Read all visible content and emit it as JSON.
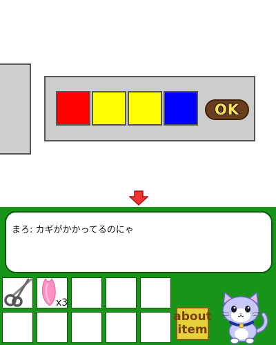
{
  "lock": {
    "slots": [
      {
        "color_name": "red",
        "color": "#ff0000"
      },
      {
        "color_name": "yellow",
        "color": "#ffff00"
      },
      {
        "color_name": "yellow",
        "color": "#ffff00"
      },
      {
        "color_name": "blue",
        "color": "#0000ff"
      }
    ],
    "ok_label": "OK"
  },
  "navigation": {
    "down_arrow_icon": "down-arrow-icon",
    "arrow_color": "#ee3333"
  },
  "dialog": {
    "message": "まろ: カギがかかってるのにゃ"
  },
  "inventory": {
    "items": [
      {
        "icon": "scissors-icon",
        "count": ""
      },
      {
        "icon": "petal-icon",
        "count": "x3"
      },
      {
        "icon": "",
        "count": ""
      },
      {
        "icon": "",
        "count": ""
      },
      {
        "icon": "",
        "count": ""
      },
      {
        "icon": "",
        "count": ""
      },
      {
        "icon": "",
        "count": ""
      },
      {
        "icon": "",
        "count": ""
      },
      {
        "icon": "",
        "count": ""
      },
      {
        "icon": "",
        "count": ""
      }
    ]
  },
  "about_item": {
    "line1": "about",
    "line2": "item"
  },
  "colors": {
    "panel_bg": "#189418",
    "lock_panel": "#cccccc",
    "ok_button": "#6a3d1f",
    "ok_text": "#f6e25a"
  }
}
